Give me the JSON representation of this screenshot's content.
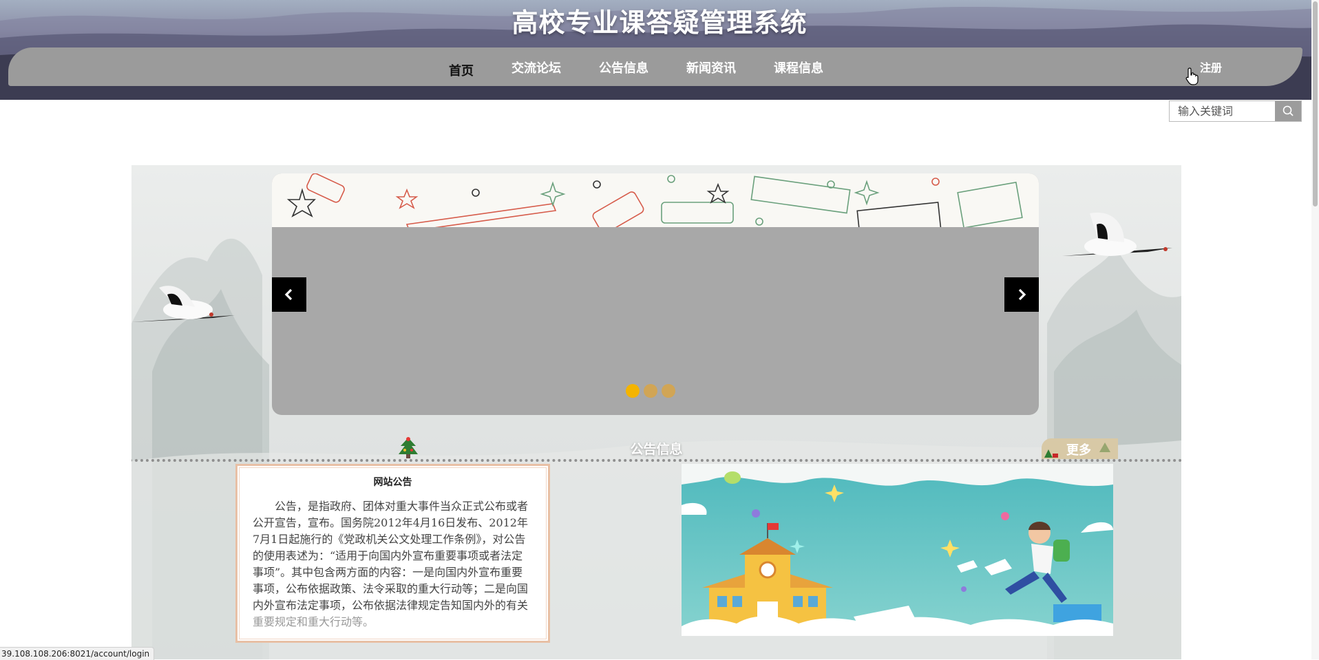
{
  "header": {
    "title": "高校专业课答疑管理系统",
    "nav": [
      {
        "label": "首页",
        "active": true
      },
      {
        "label": "交流论坛",
        "active": false
      },
      {
        "label": "公告信息",
        "active": false
      },
      {
        "label": "新闻资讯",
        "active": false
      },
      {
        "label": "课程信息",
        "active": false
      }
    ],
    "register_label": "注册"
  },
  "search": {
    "placeholder": "输入关键词",
    "icon": "search-icon"
  },
  "carousel": {
    "prev_icon": "chevron-left-icon",
    "next_icon": "chevron-right-icon",
    "active_dot": 0,
    "dot_count": 3
  },
  "notice_section": {
    "title": "公告信息",
    "more_label": "更多",
    "card_title": "网站公告",
    "card_body_main": "公告，是指政府、团体对重大事件当众正式公布或者公开宣告，宣布。国务院2012年4月16日发布、2012年7月1日起施行的《党政机关公文处理工作条例》，对公告的使用表述为：“适用于向国内外宣布重要事项或者法定事项”。其中包含两方面的内容：一是向国内外宣布重要事项，公布依据政策、法令采取的重大行动等；二是向国内外宣布法定事项，公布依据法律规定告知国内外的有关",
    "card_body_fade": "重要规定和重大行动等。"
  },
  "status_bar": {
    "url": "39.108.108.206:8021/account/login"
  },
  "colors": {
    "nav_bar": "#9b9b9b",
    "dot_active": "#f4b400",
    "dot_inactive": "#d1a555",
    "card_border": "#e8c0a5"
  }
}
